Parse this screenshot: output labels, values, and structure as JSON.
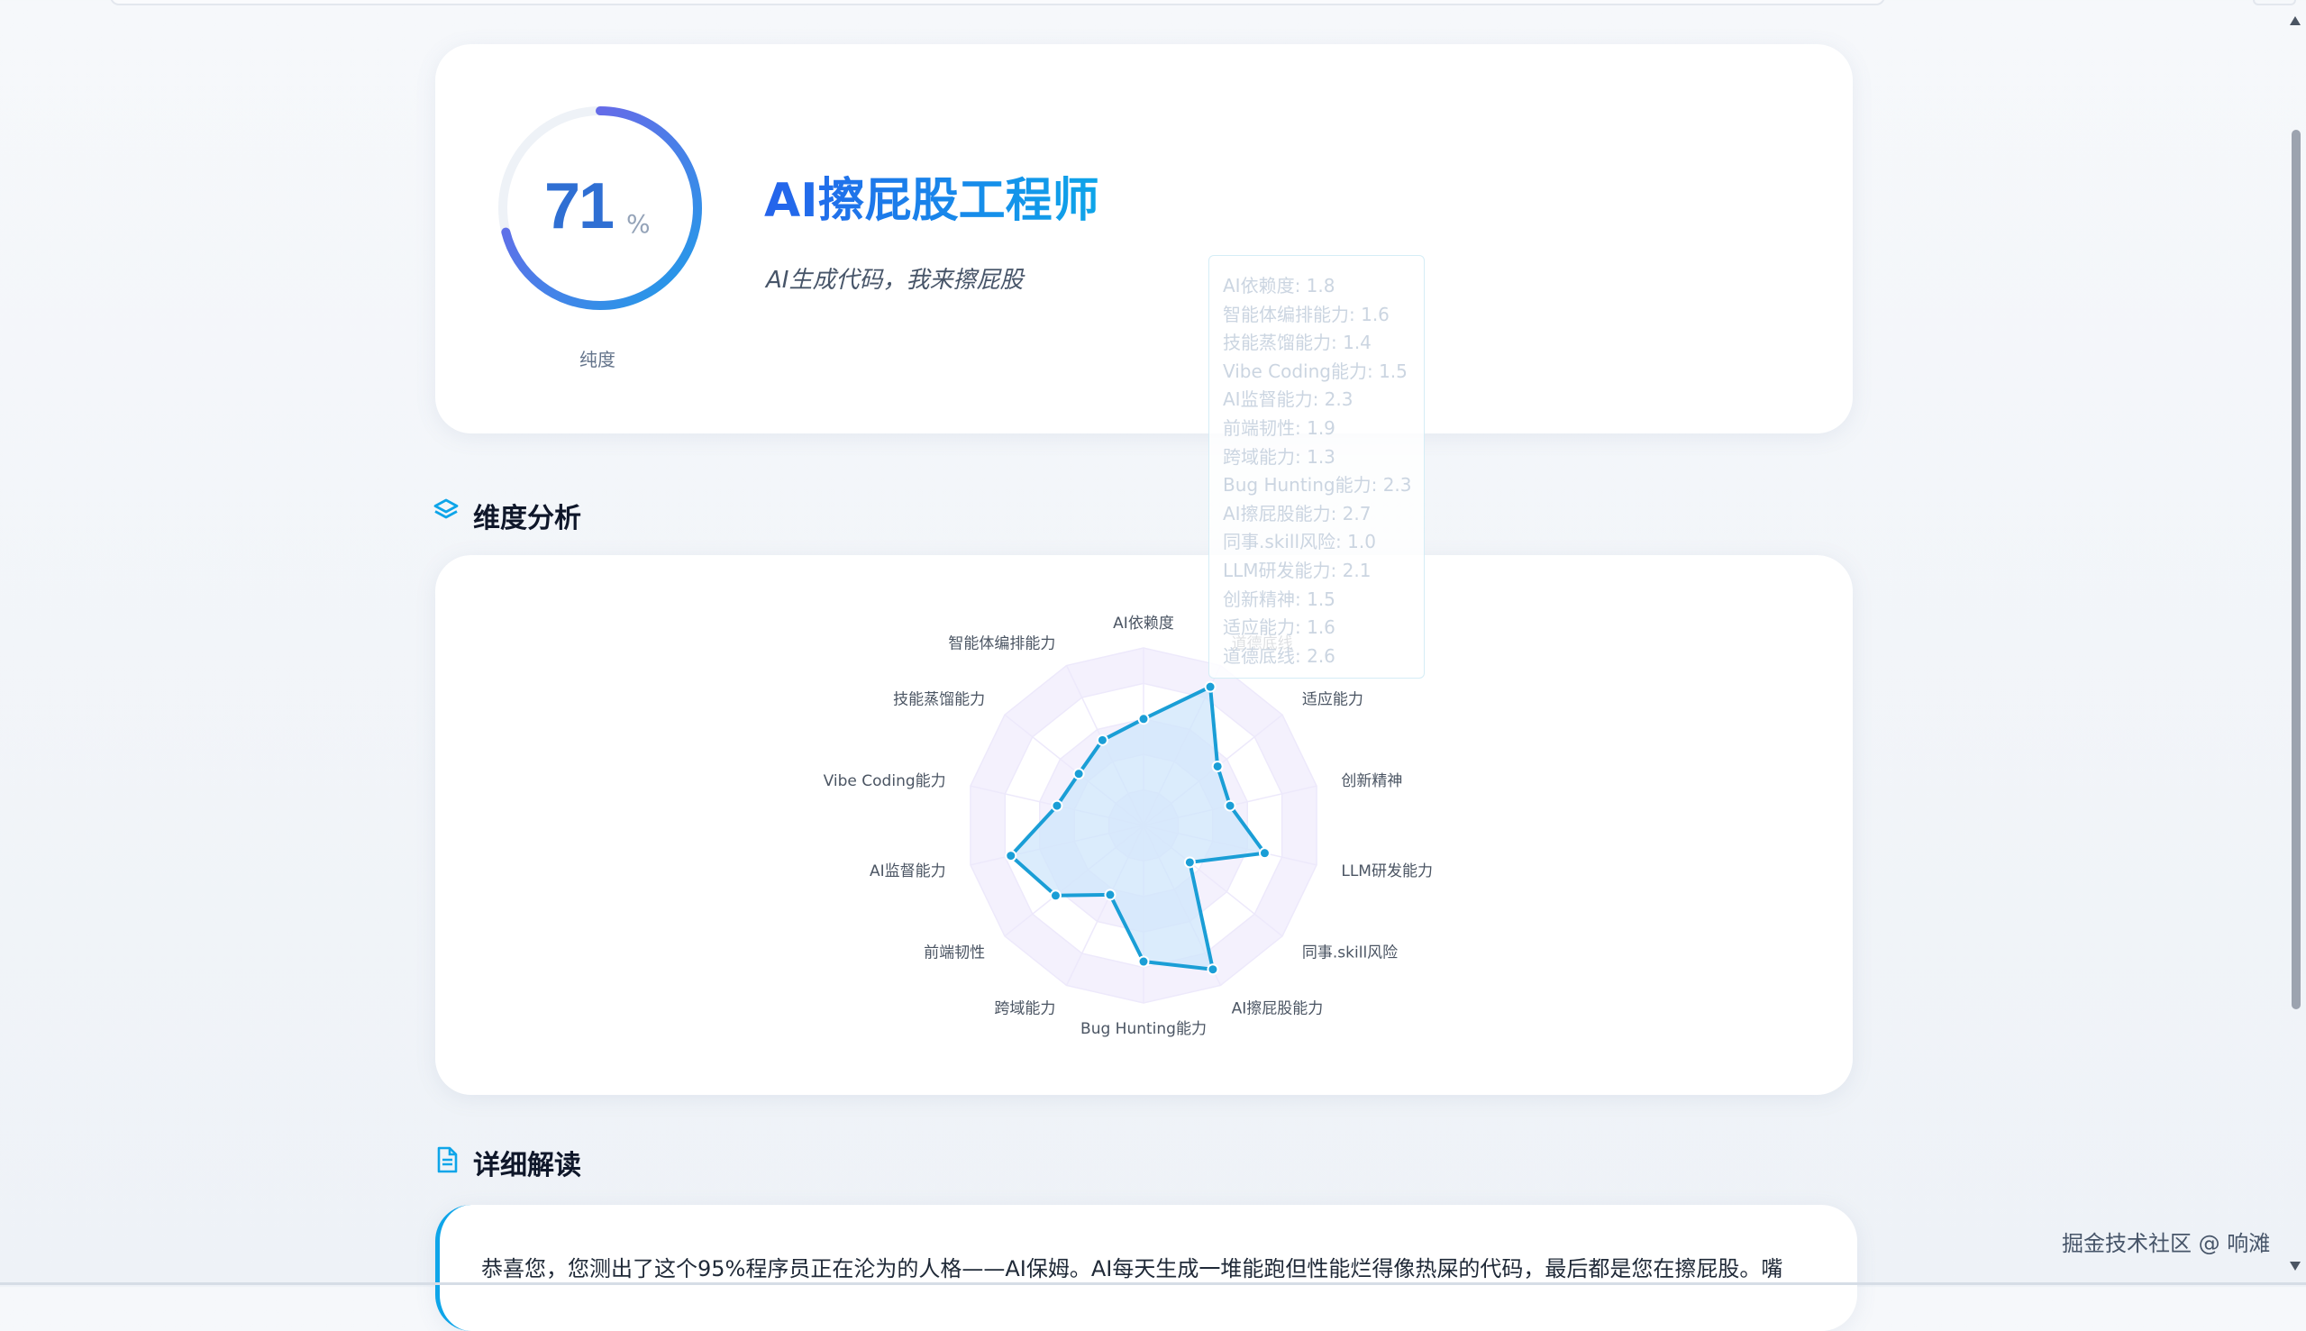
{
  "hero": {
    "score": "71",
    "score_unit": "%",
    "score_fraction": 0.71,
    "gauge_label": "纯度",
    "title": "AI擦屁股工程师",
    "subtitle": "AI生成代码，我来擦屁股"
  },
  "sections": {
    "dimension": "维度分析",
    "detail": "详细解读"
  },
  "chart_data": {
    "type": "radar",
    "max": 3,
    "axes": [
      "AI依赖度",
      "智能体编排能力",
      "技能蒸馏能力",
      "Vibe Coding能力",
      "AI监督能力",
      "前端韧性",
      "跨域能力",
      "Bug Hunting能力",
      "AI擦屁股能力",
      "同事.skill风险",
      "LLM研发能力",
      "创新精神",
      "适应能力",
      "道德底线"
    ],
    "series": [
      {
        "values": [
          1.8,
          1.6,
          1.4,
          1.5,
          2.3,
          1.9,
          1.3,
          2.3,
          2.7,
          1.0,
          2.1,
          1.5,
          1.6,
          2.6
        ]
      }
    ]
  },
  "tooltip": {
    "rows": [
      "AI依赖度: 1.8",
      "智能体编排能力: 1.6",
      "技能蒸馏能力: 1.4",
      "Vibe Coding能力: 1.5",
      "AI监督能力: 2.3",
      "前端韧性: 1.9",
      "跨域能力: 1.3",
      "Bug Hunting能力: 2.3",
      "AI擦屁股能力: 2.7",
      "同事.skill风险: 1.0",
      "LLM研发能力: 2.1",
      "创新精神: 1.5",
      "适应能力: 1.6",
      "道德底线: 2.6"
    ]
  },
  "detail": {
    "text": "恭喜您，您测出了这个95%程序员正在沦为的人格——AI保姆。AI每天生成一堆能跑但性能烂得像热屎的代码，最后都是您在擦屁股。嘴"
  },
  "watermark": "掘金技术社区 @ 响滩",
  "colors": {
    "accent": "#0ea5e9",
    "series": "#1a9ed6",
    "fill": "#cfe6fb",
    "grid": "#ede9fb"
  }
}
